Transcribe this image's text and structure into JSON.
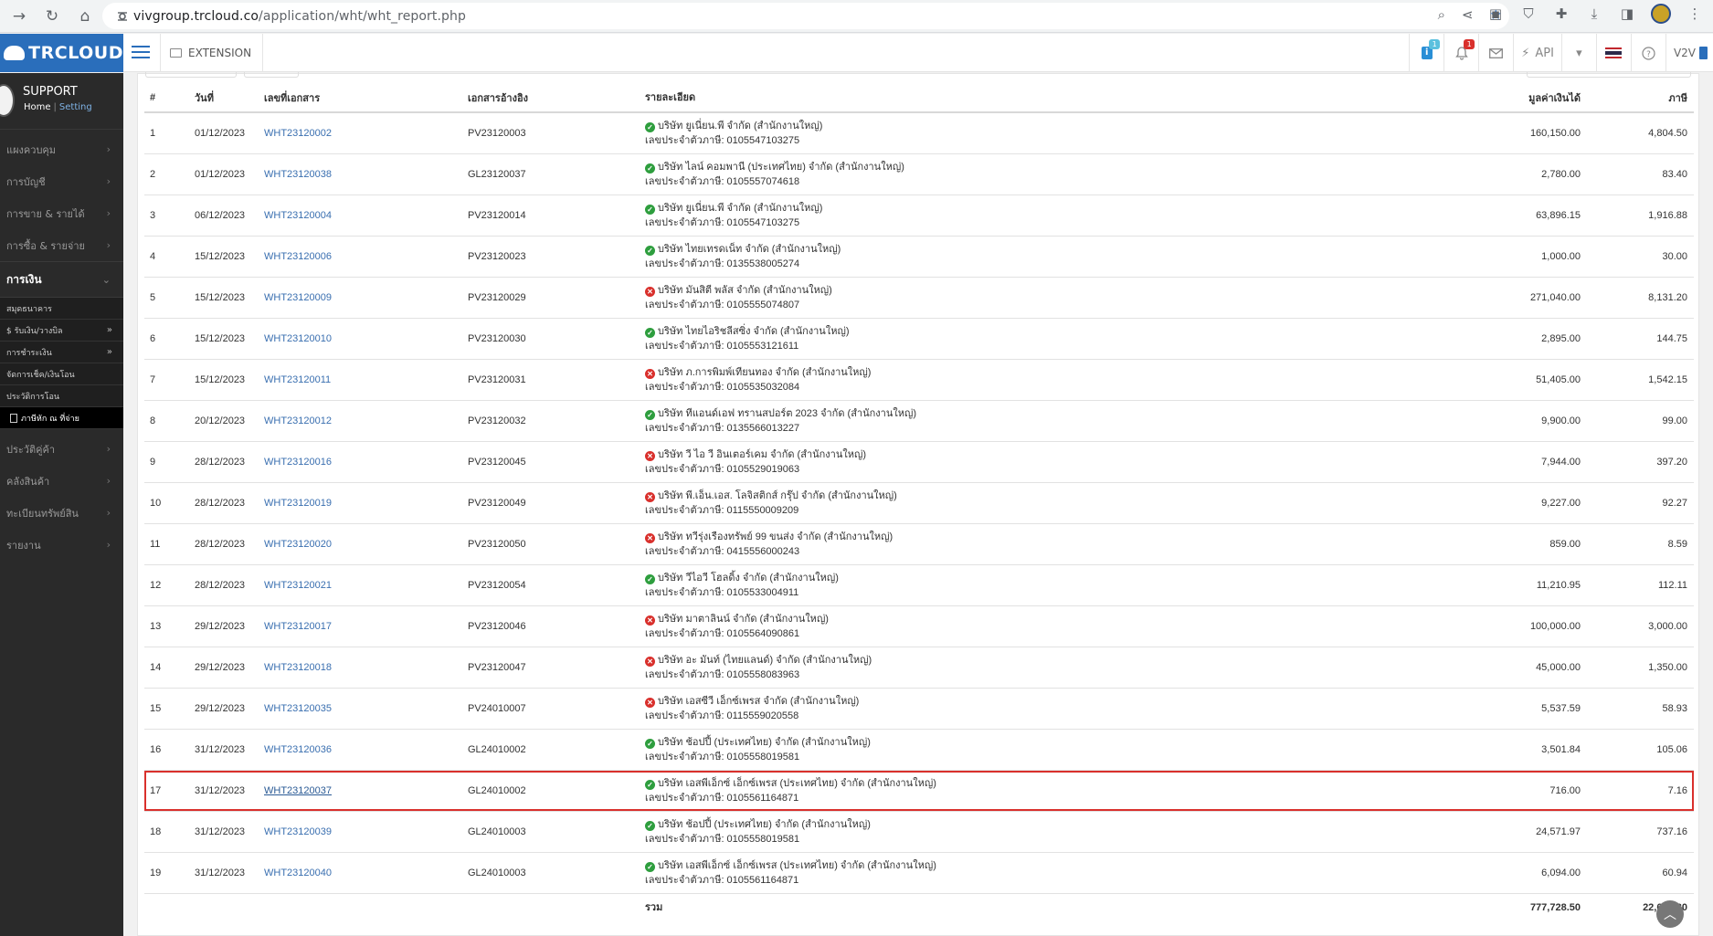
{
  "browser": {
    "url_host": "vivgroup.trcloud.co",
    "url_path": "/application/wht/wht_report.php"
  },
  "app": {
    "logo": "TRCLOUD",
    "extension_label": "EXTENSION",
    "info_badge": "1",
    "notif_badge": "1",
    "api_label": "API",
    "user_label": "V2V"
  },
  "sidebar": {
    "profile_name": "SUPPORT",
    "home_link": "Home",
    "setting_link": "Setting",
    "items_top": [
      {
        "label": "แผงควบคุม"
      },
      {
        "label": "การบัญชี"
      },
      {
        "label": "การขาย & รายได้"
      },
      {
        "label": "การซื้อ & รายจ่าย"
      }
    ],
    "active": {
      "label": "การเงิน"
    },
    "sub_items": [
      {
        "label": "สมุดธนาคาร"
      },
      {
        "label": "$ รับเงิน/วางบิล"
      },
      {
        "label": "การชำระเงิน"
      },
      {
        "label": "จัดการเช็ค/เงินโอน"
      },
      {
        "label": "ประวัติการโอน"
      },
      {
        "label": "ภาษีหัก ณ ที่จ่าย"
      }
    ],
    "items_bottom": [
      {
        "label": "ประวัติคู่ค้า"
      },
      {
        "label": "คลังสินค้า"
      },
      {
        "label": "ทะเบียนทรัพย์สิน"
      },
      {
        "label": "รายงาน"
      }
    ]
  },
  "table": {
    "headers": {
      "num": "#",
      "date": "วันที่",
      "doc": "เลขที่เอกสาร",
      "ref": "เอกสารอ้างอิง",
      "detail": "รายละเอียด",
      "amount": "มูลค่าเงินได้",
      "tax": "ภาษี"
    },
    "rows": [
      {
        "num": "1",
        "date": "01/12/2023",
        "doc": "WHT23120002",
        "ref": "PV23120003",
        "status": "ok",
        "company": "บริษัท ยูเนี่ยน.พี จำกัด (สำนักงานใหญ่)",
        "taxid": "เลขประจำตัวภาษี: 0105547103275",
        "amount": "160,150.00",
        "tax": "4,804.50"
      },
      {
        "num": "2",
        "date": "01/12/2023",
        "doc": "WHT23120038",
        "ref": "GL23120037",
        "status": "ok",
        "company": "บริษัท ไลน์ คอมพานี (ประเทศไทย) จำกัด (สำนักงานใหญ่)",
        "taxid": "เลขประจำตัวภาษี: 0105557074618",
        "amount": "2,780.00",
        "tax": "83.40"
      },
      {
        "num": "3",
        "date": "06/12/2023",
        "doc": "WHT23120004",
        "ref": "PV23120014",
        "status": "ok",
        "company": "บริษัท ยูเนี่ยน.พี จำกัด (สำนักงานใหญ่)",
        "taxid": "เลขประจำตัวภาษี: 0105547103275",
        "amount": "63,896.15",
        "tax": "1,916.88"
      },
      {
        "num": "4",
        "date": "15/12/2023",
        "doc": "WHT23120006",
        "ref": "PV23120023",
        "status": "ok",
        "company": "บริษัท ไทยเทรดเน็ท จำกัด (สำนักงานใหญ่)",
        "taxid": "เลขประจำตัวภาษี: 0135538005274",
        "amount": "1,000.00",
        "tax": "30.00"
      },
      {
        "num": "5",
        "date": "15/12/2023",
        "doc": "WHT23120009",
        "ref": "PV23120029",
        "status": "err",
        "company": "บริษัท มันสิตี พลัส จำกัด (สำนักงานใหญ่)",
        "taxid": "เลขประจำตัวภาษี: 0105555074807",
        "amount": "271,040.00",
        "tax": "8,131.20"
      },
      {
        "num": "6",
        "date": "15/12/2023",
        "doc": "WHT23120010",
        "ref": "PV23120030",
        "status": "ok",
        "company": "บริษัท ไทยไอริชลีสซิ่ง จำกัด (สำนักงานใหญ่)",
        "taxid": "เลขประจำตัวภาษี: 0105553121611",
        "amount": "2,895.00",
        "tax": "144.75"
      },
      {
        "num": "7",
        "date": "15/12/2023",
        "doc": "WHT23120011",
        "ref": "PV23120031",
        "status": "err",
        "company": "บริษัท ภ.การพิมพ์เทียนทอง จำกัด (สำนักงานใหญ่)",
        "taxid": "เลขประจำตัวภาษี: 0105535032084",
        "amount": "51,405.00",
        "tax": "1,542.15"
      },
      {
        "num": "8",
        "date": "20/12/2023",
        "doc": "WHT23120012",
        "ref": "PV23120032",
        "status": "ok",
        "company": "บริษัท ทีแอนด์เอฟ ทรานสปอร์ต 2023 จำกัด (สำนักงานใหญ่)",
        "taxid": "เลขประจำตัวภาษี: 0135566013227",
        "amount": "9,900.00",
        "tax": "99.00"
      },
      {
        "num": "9",
        "date": "28/12/2023",
        "doc": "WHT23120016",
        "ref": "PV23120045",
        "status": "err",
        "company": "บริษัท วี ไอ วี อินเตอร์เคม จำกัด (สำนักงานใหญ่)",
        "taxid": "เลขประจำตัวภาษี: 0105529019063",
        "amount": "7,944.00",
        "tax": "397.20"
      },
      {
        "num": "10",
        "date": "28/12/2023",
        "doc": "WHT23120019",
        "ref": "PV23120049",
        "status": "err",
        "company": "บริษัท พี.เอ็น.เอส. โลจิสติกส์ กรุ๊ป จำกัด (สำนักงานใหญ่)",
        "taxid": "เลขประจำตัวภาษี: 0115550009209",
        "amount": "9,227.00",
        "tax": "92.27"
      },
      {
        "num": "11",
        "date": "28/12/2023",
        "doc": "WHT23120020",
        "ref": "PV23120050",
        "status": "err",
        "company": "บริษัท ทวีรุ่งเรืองทรัพย์ 99 ขนส่ง จำกัด (สำนักงานใหญ่)",
        "taxid": "เลขประจำตัวภาษี: 0415556000243",
        "amount": "859.00",
        "tax": "8.59"
      },
      {
        "num": "12",
        "date": "28/12/2023",
        "doc": "WHT23120021",
        "ref": "PV23120054",
        "status": "ok",
        "company": "บริษัท วีไอวี โฮลดิ้ง จำกัด (สำนักงานใหญ่)",
        "taxid": "เลขประจำตัวภาษี: 0105533004911",
        "amount": "11,210.95",
        "tax": "112.11"
      },
      {
        "num": "13",
        "date": "29/12/2023",
        "doc": "WHT23120017",
        "ref": "PV23120046",
        "status": "err",
        "company": "บริษัท มาตาลินน์ จำกัด (สำนักงานใหญ่)",
        "taxid": "เลขประจำตัวภาษี: 0105564090861",
        "amount": "100,000.00",
        "tax": "3,000.00"
      },
      {
        "num": "14",
        "date": "29/12/2023",
        "doc": "WHT23120018",
        "ref": "PV23120047",
        "status": "err",
        "company": "บริษัท อะ มันท์ (ไทยแลนด์) จำกัด (สำนักงานใหญ่)",
        "taxid": "เลขประจำตัวภาษี: 0105558083963",
        "amount": "45,000.00",
        "tax": "1,350.00"
      },
      {
        "num": "15",
        "date": "29/12/2023",
        "doc": "WHT23120035",
        "ref": "PV24010007",
        "status": "err",
        "company": "บริษัท เอสซีวี เอ็กซ์เพรส จำกัด (สำนักงานใหญ่)",
        "taxid": "เลขประจำตัวภาษี: 0115559020558",
        "amount": "5,537.59",
        "tax": "58.93"
      },
      {
        "num": "16",
        "date": "31/12/2023",
        "doc": "WHT23120036",
        "ref": "GL24010002",
        "status": "ok",
        "company": "บริษัท ช้อปปี้ (ประเทศไทย) จำกัด (สำนักงานใหญ่)",
        "taxid": "เลขประจำตัวภาษี: 0105558019581",
        "amount": "3,501.84",
        "tax": "105.06"
      },
      {
        "num": "17",
        "date": "31/12/2023",
        "doc": "WHT23120037",
        "ref": "GL24010002",
        "status": "ok",
        "company": "บริษัท เอสพีเอ็กซ์ เอ็กซ์เพรส (ประเทศไทย) จำกัด (สำนักงานใหญ่)",
        "taxid": "เลขประจำตัวภาษี: 0105561164871",
        "amount": "716.00",
        "tax": "7.16",
        "highlight": true
      },
      {
        "num": "18",
        "date": "31/12/2023",
        "doc": "WHT23120039",
        "ref": "GL24010003",
        "status": "ok",
        "company": "บริษัท ช้อปปี้ (ประเทศไทย) จำกัด (สำนักงานใหญ่)",
        "taxid": "เลขประจำตัวภาษี: 0105558019581",
        "amount": "24,571.97",
        "tax": "737.16"
      },
      {
        "num": "19",
        "date": "31/12/2023",
        "doc": "WHT23120040",
        "ref": "GL24010003",
        "status": "ok",
        "company": "บริษัท เอสพีเอ็กซ์ เอ็กซ์เพรส (ประเทศไทย) จำกัด (สำนักงานใหญ่)",
        "taxid": "เลขประจำตัวภาษี: 0105561164871",
        "amount": "6,094.00",
        "tax": "60.94"
      }
    ],
    "total": {
      "label": "รวม",
      "amount": "777,728.50",
      "tax": "22,681.30"
    }
  },
  "colors": {
    "ok": "#2e9e3e",
    "err": "#d9302c",
    "link": "#3a6fb0",
    "brand": "#2a6ebb"
  }
}
